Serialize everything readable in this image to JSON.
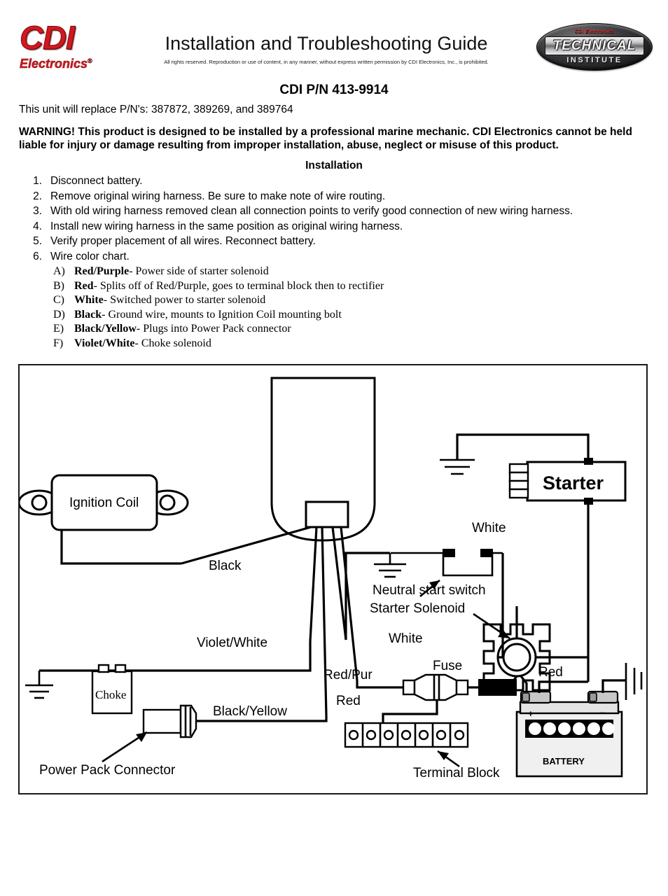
{
  "header": {
    "logo_text_main": "CDI",
    "logo_text_sub": "Electronics",
    "logo_trademark": "®",
    "title": "Installation and Troubleshooting Guide",
    "legal": "All rights reserved. Reproduction or use of content, in any manner, without  express written permission by CDI Electronics, Inc., is prohibited.",
    "badge_top_text": "CDI Electronics",
    "badge_main_text": "TECHNICAL",
    "badge_sub_text": "INSTITUTE",
    "brand_red": "#d0191f"
  },
  "document": {
    "part_number": "CDI P/N 413-9914",
    "replaces": "This unit will replace P/N's: 387872, 389269, and 389764",
    "warning": "WARNING!  This product is designed to be installed by a professional marine mechanic. CDI Electronics cannot be held liable for injury or damage resulting from improper installation, abuse, neglect or misuse of this product.",
    "section_heading": "Installation",
    "steps": [
      {
        "num": "1.",
        "text": "Disconnect battery."
      },
      {
        "num": "2.",
        "text": "Remove original wiring harness. Be sure to make note of wire routing."
      },
      {
        "num": "3.",
        "text": "With old wiring harness removed clean all connection points to verify good connection of new wiring harness."
      },
      {
        "num": "4.",
        "text": "Install new wiring harness in the same position as original wiring harness."
      },
      {
        "num": "5.",
        "text": "Verify proper placement of all wires. Reconnect battery."
      },
      {
        "num": "6.",
        "text": "Wire color chart."
      }
    ],
    "wire_chart": [
      {
        "letter": "A)",
        "color": "Red/Purple",
        "desc": "- Power side of starter solenoid"
      },
      {
        "letter": "B)",
        "color": "Red",
        "desc": "- Splits off of Red/Purple, goes to terminal block then to rectifier"
      },
      {
        "letter": "C)",
        "color": "White",
        "desc": "- Switched power to starter solenoid"
      },
      {
        "letter": "D)",
        "color": "Black",
        "desc": "- Ground wire, mounts to Ignition Coil mounting bolt"
      },
      {
        "letter": "E)",
        "color": "Black/Yellow",
        "desc": "- Plugs into Power Pack connector"
      },
      {
        "letter": "F)",
        "color": "Violet/White",
        "desc": "- Choke solenoid"
      }
    ]
  },
  "diagram": {
    "components": {
      "ignition_coil": "Ignition Coil",
      "choke": "Choke",
      "starter": "Starter",
      "battery": "BATTERY",
      "battery_positive": "+",
      "battery_negative": "–"
    },
    "callouts": {
      "neutral_start_switch": "Neutral start switch",
      "starter_solenoid": "Starter Solenoid",
      "power_pack_connector": "Power Pack Connector",
      "terminal_block": "Terminal Block",
      "fuse": "Fuse"
    },
    "wire_labels": {
      "black": "Black",
      "violet_white": "Violet/White",
      "black_yellow": "Black/Yellow",
      "white_top": "White",
      "white_mid": "White",
      "red_pur": "Red/Pur",
      "red_left": "Red",
      "red_right": "Red"
    }
  }
}
